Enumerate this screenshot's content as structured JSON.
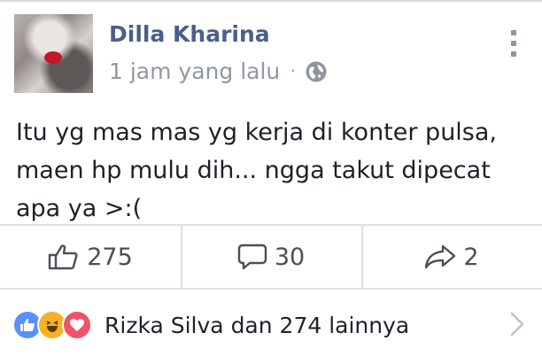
{
  "post": {
    "author": "Dilla Kharina",
    "time": "1 jam yang lalu",
    "separator": "·",
    "privacy_icon": "globe-icon",
    "menu_icon": "vertical-dots-icon",
    "text_lines": [
      "Itu yg mas mas yg kerja di konter pulsa,",
      "maen hp mulu dih... ngga takut dipecat",
      "apa ya >:("
    ]
  },
  "actions": {
    "like_count": "275",
    "comment_count": "30",
    "share_count": "2"
  },
  "reactions": {
    "icons": [
      "like-reaction-icon",
      "haha-reaction-icon",
      "love-reaction-icon"
    ],
    "summary": "Rizka Silva dan 274 lainnya"
  },
  "colors": {
    "name": "#4b5f8c",
    "meta": "#9197a3",
    "text": "#1d2129",
    "divider": "#dddfe2",
    "like": "#5890ff",
    "haha": "#f7b125",
    "love": "#f25268"
  }
}
